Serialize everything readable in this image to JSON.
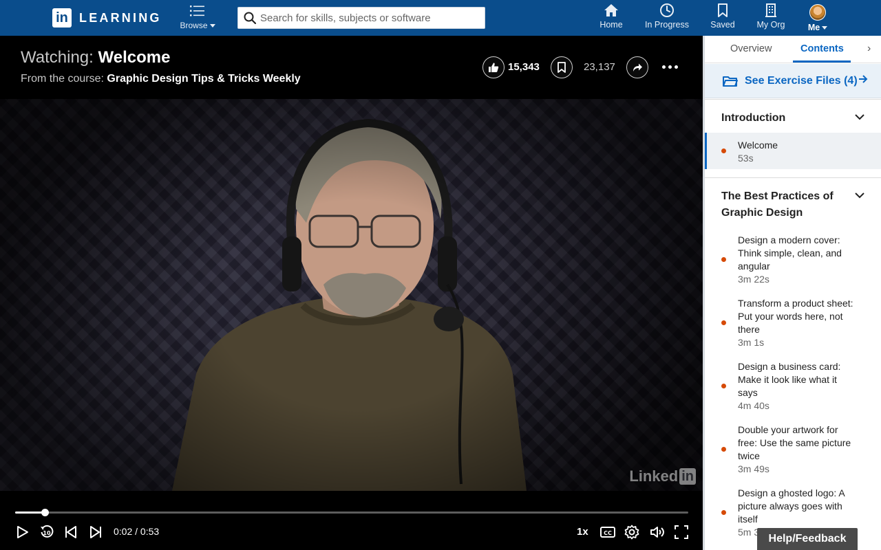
{
  "header": {
    "brand_in": "in",
    "brand_word": "LEARNING",
    "browse_label": "Browse",
    "search_placeholder": "Search for skills, subjects or software",
    "nav": [
      {
        "label": "Home",
        "icon": "home-icon"
      },
      {
        "label": "In Progress",
        "icon": "clock-icon"
      },
      {
        "label": "Saved",
        "icon": "bookmark-icon"
      },
      {
        "label": "My Org",
        "icon": "building-icon"
      },
      {
        "label": "Me",
        "icon": "avatar"
      }
    ]
  },
  "player": {
    "watching_prefix": "Watching:",
    "watching_title": "Welcome",
    "from_prefix": "From the course:",
    "course_title": "Graphic Design Tips & Tricks Weekly",
    "likes": "15,343",
    "saves": "23,137",
    "watermark_text": "Linked",
    "watermark_in": "in",
    "progress_fraction": 0.044,
    "time": "0:02 / 0:53",
    "speed": "1x",
    "colors": {
      "accent": "#0a66c2",
      "nav_bg": "#0a4d8c",
      "dot": "#d64a07"
    }
  },
  "panel": {
    "tabs": [
      "Overview",
      "Contents"
    ],
    "active_tab": "Contents",
    "exercise_files": "See Exercise Files (4)",
    "chapters": [
      {
        "title": "Introduction",
        "lessons": [
          {
            "title": "Welcome",
            "duration": "53s"
          }
        ]
      },
      {
        "title": "The Best Practices of Graphic Design",
        "lessons": [
          {
            "title": "Design a modern cover: Think simple, clean, and angular",
            "duration": "3m 22s"
          },
          {
            "title": "Transform a product sheet: Put your words here, not there",
            "duration": "3m 1s"
          },
          {
            "title": "Design a business card: Make it look like what it says",
            "duration": "4m 40s"
          },
          {
            "title": "Double your artwork for free: Use the same picture twice",
            "duration": "3m 49s"
          },
          {
            "title": "Design a ghosted logo: A picture always goes with itself",
            "duration": "5m 39s"
          }
        ]
      }
    ]
  },
  "feedback_label": "Help/Feedback"
}
